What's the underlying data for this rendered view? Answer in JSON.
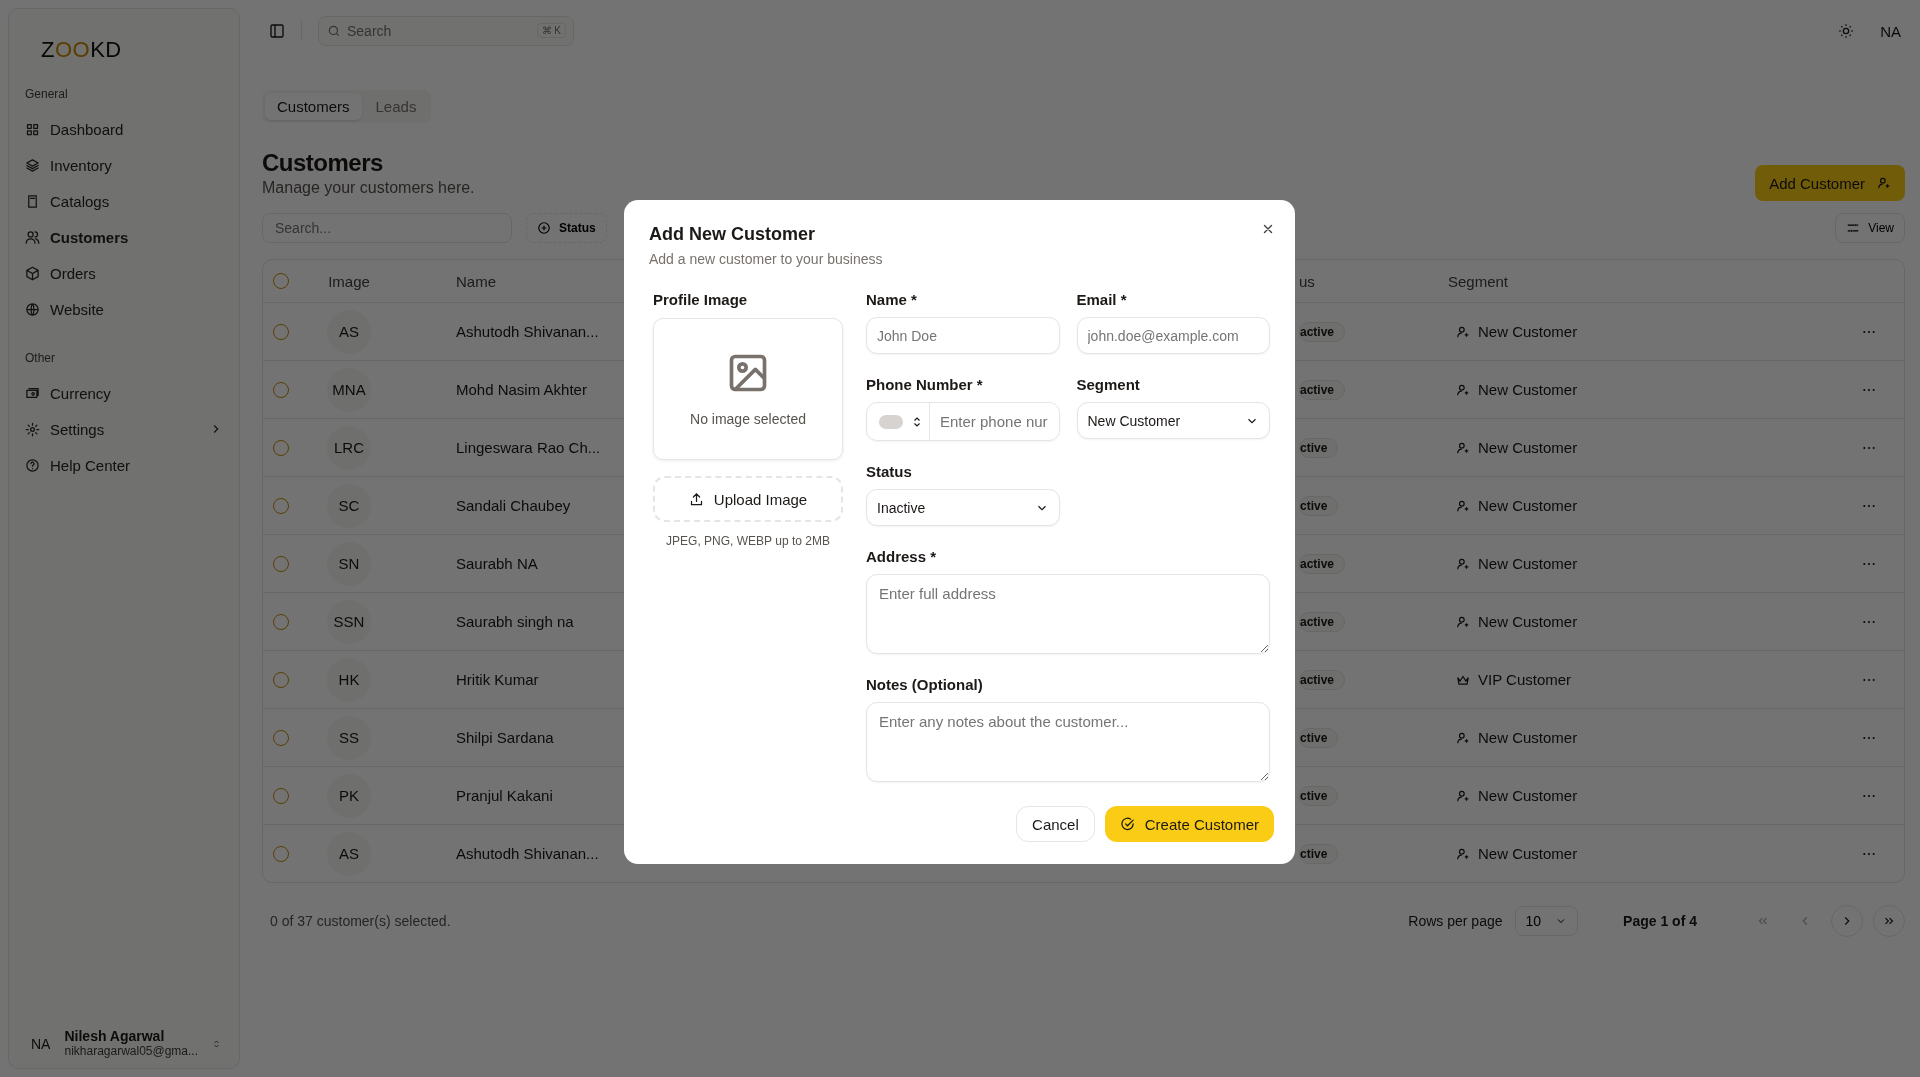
{
  "sidebar": {
    "logo": [
      {
        "text": "Z",
        "accent": false
      },
      {
        "text": "OO",
        "accent": true
      },
      {
        "text": "KD",
        "accent": false
      }
    ],
    "groups": [
      {
        "label": "General",
        "items": [
          {
            "label": "Dashboard",
            "selected": false,
            "expandable": false
          },
          {
            "label": "Inventory",
            "selected": false,
            "expandable": false
          },
          {
            "label": "Catalogs",
            "selected": false,
            "expandable": false
          },
          {
            "label": "Customers",
            "selected": true,
            "expandable": false
          },
          {
            "label": "Orders",
            "selected": false,
            "expandable": false
          },
          {
            "label": "Website",
            "selected": false,
            "expandable": false
          }
        ]
      },
      {
        "label": "Other",
        "items": [
          {
            "label": "Currency",
            "selected": false,
            "expandable": false
          },
          {
            "label": "Settings",
            "selected": false,
            "expandable": true
          },
          {
            "label": "Help Center",
            "selected": false,
            "expandable": false
          }
        ]
      }
    ],
    "user": {
      "initials": "NA",
      "name": "Nilesh Agarwal",
      "email": "nikharagarwal05@gma..."
    }
  },
  "topbar": {
    "search_placeholder": "Search",
    "shortcut": "⌘ K",
    "user_initials": "NA"
  },
  "tabs": [
    {
      "label": "Customers",
      "selected": true
    },
    {
      "label": "Leads",
      "selected": false
    }
  ],
  "page": {
    "title": "Customers",
    "subtitle": "Manage your customers here.",
    "add_button": "Add Customer"
  },
  "toolbar": {
    "search_placeholder": "Search...",
    "filter": "Status",
    "view": "View"
  },
  "table": {
    "all_selected": false,
    "columns": [
      "Image",
      "Name",
      "us",
      "Segment"
    ],
    "rows": [
      {
        "selected": false,
        "initials": "AS",
        "name": "Ashutodh Shivanan...",
        "status": "active",
        "segment": {
          "kind": "new",
          "label": "New Customer"
        }
      },
      {
        "selected": false,
        "initials": "MNA",
        "name": "Mohd Nasim Akhter",
        "status": "active",
        "segment": {
          "kind": "new",
          "label": "New Customer"
        }
      },
      {
        "selected": false,
        "initials": "LRC",
        "name": "Lingeswara Rao Ch...",
        "status": "ctive",
        "segment": {
          "kind": "new",
          "label": "New Customer"
        }
      },
      {
        "selected": false,
        "initials": "SC",
        "name": "Sandali Chaubey",
        "status": "ctive",
        "segment": {
          "kind": "new",
          "label": "New Customer"
        }
      },
      {
        "selected": false,
        "initials": "SN",
        "name": "Saurabh NA",
        "status": "active",
        "segment": {
          "kind": "new",
          "label": "New Customer"
        }
      },
      {
        "selected": false,
        "initials": "SSN",
        "name": "Saurabh singh na",
        "status": "active",
        "segment": {
          "kind": "new",
          "label": "New Customer"
        }
      },
      {
        "selected": false,
        "initials": "HK",
        "name": "Hritik Kumar",
        "status": "active",
        "segment": {
          "kind": "vip",
          "label": "VIP Customer"
        }
      },
      {
        "selected": false,
        "initials": "SS",
        "name": "Shilpi Sardana",
        "status": "ctive",
        "segment": {
          "kind": "new",
          "label": "New Customer"
        }
      },
      {
        "selected": false,
        "initials": "PK",
        "name": "Pranjul Kakani",
        "status": "ctive",
        "segment": {
          "kind": "new",
          "label": "New Customer"
        }
      },
      {
        "selected": false,
        "initials": "AS",
        "name": "Ashutodh Shivanan...",
        "status": "ctive",
        "segment": {
          "kind": "new",
          "label": "New Customer"
        }
      }
    ]
  },
  "footer": {
    "selection": "0 of 37 customer(s) selected.",
    "rows_per_page_label": "Rows per page",
    "rows_per_page": "10",
    "page": "Page 1 of 4"
  },
  "dialog": {
    "title": "Add New Customer",
    "description": "Add a new customer to your business",
    "profile": {
      "label": "Profile Image",
      "empty_text": "No image selected",
      "upload_button": "Upload Image",
      "hint": "JPEG, PNG, WEBP up to 2MB"
    },
    "fields": [
      {
        "kind": "text",
        "label": "Name *",
        "placeholder": "John Doe"
      },
      {
        "kind": "text",
        "label": "Email *",
        "placeholder": "john.doe@example.com"
      },
      {
        "kind": "phone",
        "label": "Phone Number *",
        "placeholder": "Enter phone nur"
      },
      {
        "kind": "select",
        "label": "Segment",
        "value": "New Customer"
      },
      {
        "kind": "select",
        "label": "Status",
        "value": "Inactive"
      },
      {
        "kind": "textarea",
        "label": "Address *",
        "placeholder": "Enter full address"
      },
      {
        "kind": "textarea",
        "label": "Notes (Optional)",
        "placeholder": "Enter any notes about the customer..."
      }
    ],
    "cancel": "Cancel",
    "submit": "Create Customer"
  }
}
